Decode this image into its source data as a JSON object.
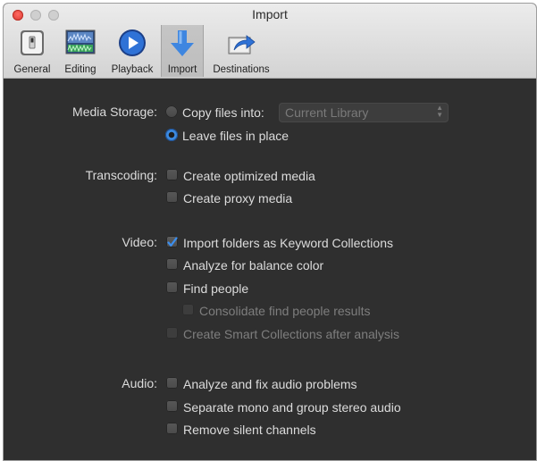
{
  "window": {
    "title": "Import"
  },
  "toolbar": {
    "items": [
      {
        "label": "General",
        "icon": "general-switch-icon"
      },
      {
        "label": "Editing",
        "icon": "editing-timeline-icon"
      },
      {
        "label": "Playback",
        "icon": "playback-play-icon"
      },
      {
        "label": "Import",
        "icon": "import-arrow-icon",
        "selected": true
      },
      {
        "label": "Destinations",
        "icon": "destinations-share-icon"
      }
    ]
  },
  "media_storage": {
    "label": "Media Storage:",
    "copy_label": "Copy files into:",
    "copy_selected": false,
    "library_value": "Current Library",
    "leave_label": "Leave files in place",
    "leave_selected": true
  },
  "transcoding": {
    "label": "Transcoding:",
    "optimized_label": "Create optimized media",
    "optimized_checked": false,
    "proxy_label": "Create proxy media",
    "proxy_checked": false
  },
  "video": {
    "label": "Video:",
    "keyword_label": "Import folders as Keyword Collections",
    "keyword_checked": true,
    "balance_label": "Analyze for balance color",
    "balance_checked": false,
    "find_people_label": "Find people",
    "find_people_checked": false,
    "consolidate_label": "Consolidate find people results",
    "consolidate_checked": false,
    "smart_label": "Create Smart Collections after analysis",
    "smart_checked": false
  },
  "audio": {
    "label": "Audio:",
    "fix_label": "Analyze and fix audio problems",
    "fix_checked": false,
    "separate_label": "Separate mono and group stereo audio",
    "separate_checked": false,
    "silent_label": "Remove silent channels",
    "silent_checked": false
  },
  "colors": {
    "accent": "#2f7fd8",
    "content_bg": "#2f2f2f",
    "titlebar_bg": "#dcdcdc"
  }
}
